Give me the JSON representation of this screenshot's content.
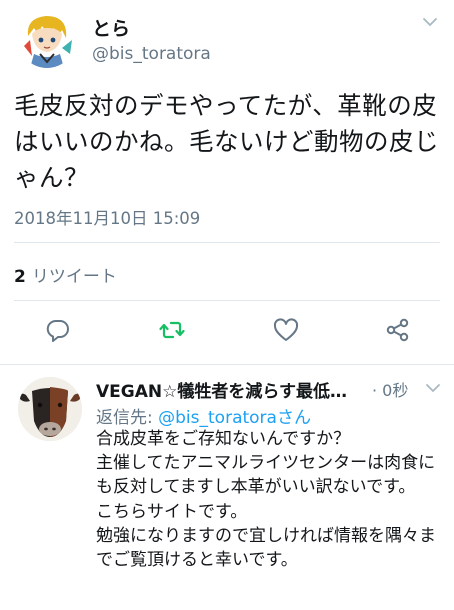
{
  "tweet": {
    "display_name": "とら",
    "handle": "@bis_toratora",
    "text": "毛皮反対のデモやってたが、革靴の皮はいいのかね。毛ないけど動物の皮じゃん？",
    "timestamp": "2018年11月10日 15:09",
    "retweet_count": "2",
    "retweet_label": "リツイート",
    "avatar": "anime-character-avatar",
    "menu_icon": "chevron-down-icon"
  },
  "actions": {
    "reply_icon": "reply-icon",
    "retweet_icon": "retweet-icon",
    "like_icon": "heart-icon",
    "share_icon": "share-icon"
  },
  "reply": {
    "display_name": "VEGAN☆犠牲者を減らす最低…",
    "time": "· 0秒",
    "reply_to_prefix": "返信先: ",
    "reply_to_handle": "@bis_toratora",
    "reply_to_suffix": "さん",
    "text": "合成皮革をご存知ないんですか？\n主催してたアニマルライツセンターは肉食にも反対してますし本革がいい訳ないです。\nこちらサイトです。\n勉強になりますので宜しければ情報を隅々までご覧頂けると幸いです。",
    "avatar": "cow-face-avatar",
    "menu_icon": "chevron-down-icon"
  },
  "colors": {
    "text": "#14171a",
    "secondary": "#657786",
    "link": "#1da1f2",
    "retweet_green": "#17bf63",
    "divider": "#e1e8ed"
  }
}
